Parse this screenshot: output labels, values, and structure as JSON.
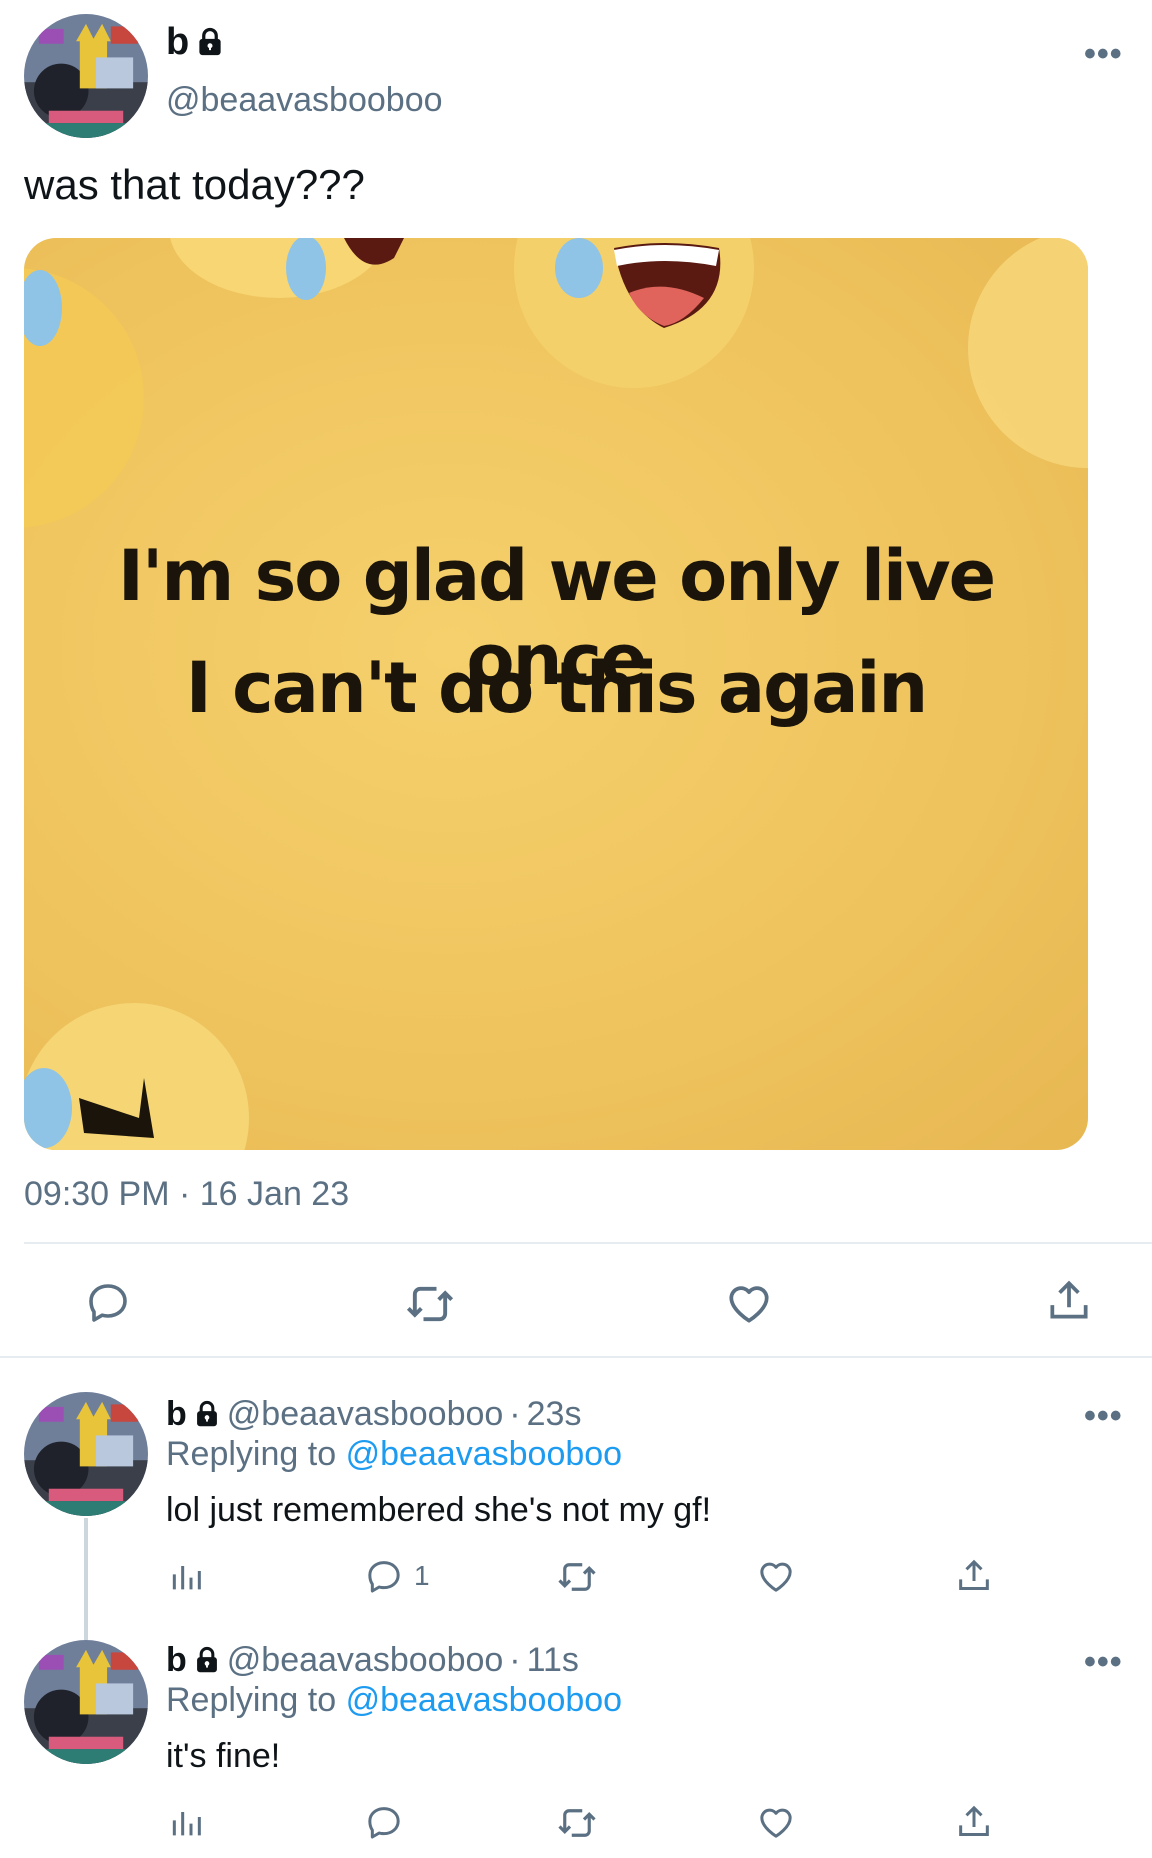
{
  "main_tweet": {
    "display_name": "b",
    "handle": "@beaavasbooboo",
    "text": "was that today???",
    "image_text_line1": "I'm so glad we only live once",
    "image_text_line2": "I can't do this again",
    "time": "09:30 PM",
    "date": "16 Jan 23",
    "separator": "·"
  },
  "replies": [
    {
      "display_name": "b",
      "handle": "@beaavasbooboo",
      "age": "23s",
      "replying_prefix": "Replying to",
      "replying_handle": "@beaavasbooboo",
      "text": "lol just remembered she's not my gf!",
      "reply_count": "1"
    },
    {
      "display_name": "b",
      "handle": "@beaavasbooboo",
      "age": "11s",
      "replying_prefix": "Replying to",
      "replying_handle": "@beaavasbooboo",
      "text": "it's fine!",
      "reply_count": ""
    }
  ],
  "icons": {
    "more": "more-icon",
    "lock": "lock-icon",
    "reply": "reply-icon",
    "retweet": "retweet-icon",
    "like": "like-icon",
    "share": "share-icon",
    "analytics": "analytics-icon"
  },
  "colors": {
    "link": "#1d9bf0",
    "muted": "#5b7083",
    "divider": "#e6ecf0",
    "media_bg": "#efc45e"
  }
}
